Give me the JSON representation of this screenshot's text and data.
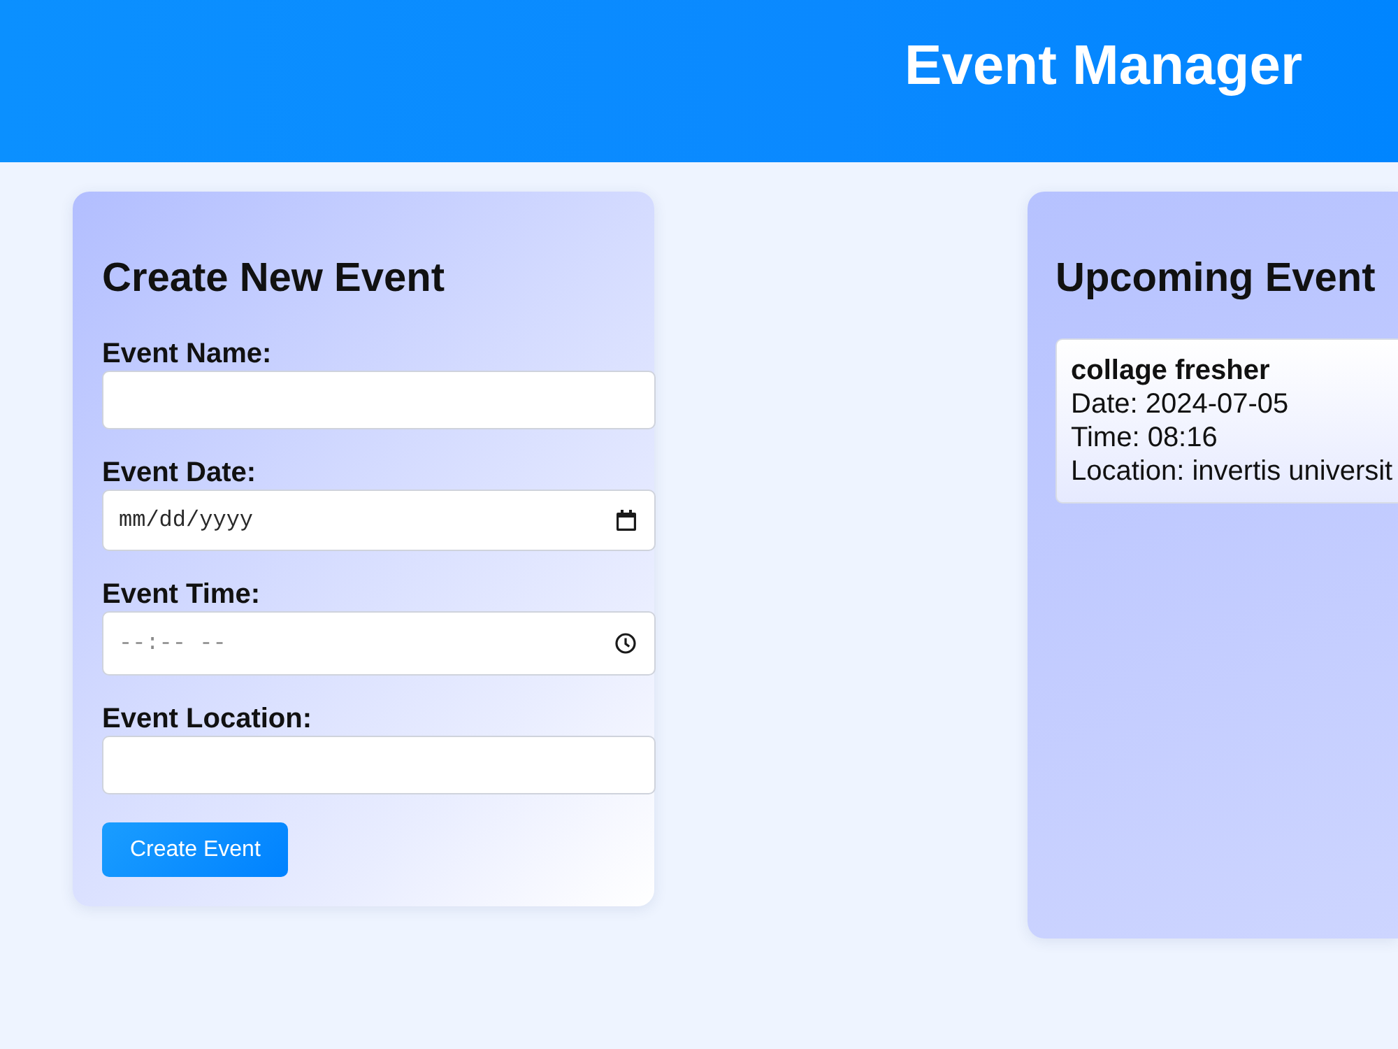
{
  "header": {
    "title": "Event Manager"
  },
  "create_form": {
    "title": "Create New Event",
    "fields": [
      {
        "label": "Event Name:",
        "kind": "text"
      },
      {
        "label": "Event Date:",
        "kind": "date",
        "placeholder": "mm/dd/yyyy"
      },
      {
        "label": "Event Time:",
        "kind": "time",
        "placeholder": "--:-- --"
      },
      {
        "label": "Event Location:",
        "kind": "text"
      }
    ],
    "submit_button": "Create Event"
  },
  "upcoming": {
    "title": "Upcoming Event",
    "events": [
      {
        "name": "collage fresher",
        "date": "Date: 2024-07-05",
        "time": "Time: 08:16",
        "location": "Location: invertis universit"
      }
    ]
  }
}
